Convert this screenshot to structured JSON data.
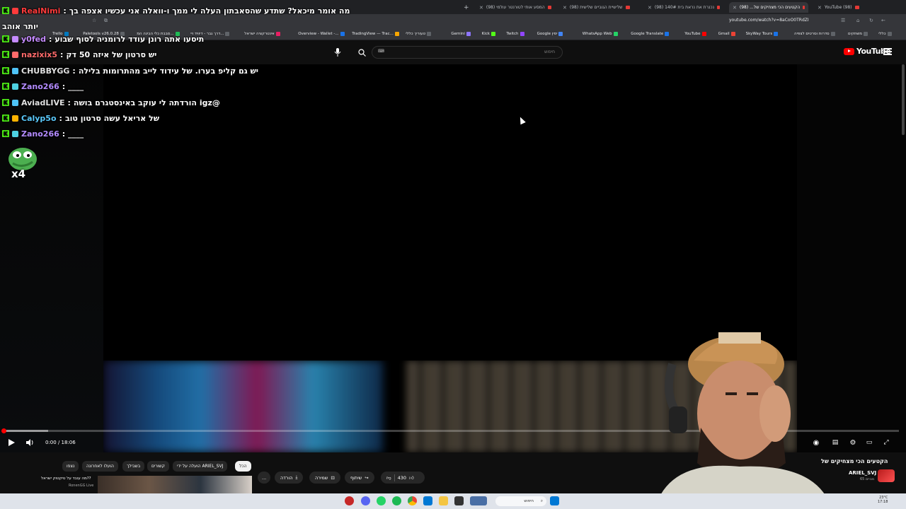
{
  "browser": {
    "tabs": [
      {
        "label": "YouTube (98)"
      },
      {
        "label": "הקטעים הכי מצחיקים של... (98)"
      },
      {
        "label": "נכנרת את נראת בית 140# (98)"
      },
      {
        "label": "שלישיית הגוביים שלישית (98)"
      },
      {
        "label": "המסע אותי לטורנטר עולמי (98)"
      }
    ],
    "new_tab": "+",
    "url": "youtube.com/watch?v=8aCoO0TRdZI",
    "bookmarks": [
      "כללי",
      "משחקים",
      "סדרות וסרטים לצפיה",
      "SkyWay Tours",
      "Gmail",
      "YouTube",
      "Google Translate",
      "WhatsApp Web",
      "Google ימין",
      "Twitch",
      "Kick",
      "Gemini",
      "טעוריך כללי",
      "TradingView — Trac...",
      "Overview - Wallet -...",
      "אינטרקציה ישראל",
      "דרך גבר - דיוויד ויי...",
      "סבבת כלי הבינה המ...",
      "Paletools v26.0.28",
      "Trello"
    ]
  },
  "youtube": {
    "logo_text": "YouTube",
    "search_placeholder": "חיפוש",
    "video": {
      "current_time": "0:00",
      "duration": "18:06",
      "time_display": "0:00 / 18:06",
      "progress": 0.0
    },
    "title": "הקטעים הכי מצחיקים של",
    "channel": "ARIEL_SVJ",
    "subscribers": "65 מנויים",
    "chips": [
      "הכל",
      "הועלה על ידי ARIEL_SVJ",
      "קשורים",
      "בשבילך",
      "הועלו לאחרונה",
      "נצפו"
    ],
    "actions": {
      "likes": "430",
      "share": "שיתוף",
      "save": "שמירה",
      "download": "הורדה",
      "more": "..."
    },
    "suggestion": {
      "title": "מה עובד על טיקטוק ישראל??",
      "channel": "RonenGG Live"
    }
  },
  "chat": [
    {
      "user": "RealNimi",
      "color": "#ff3b3b",
      "message": "מה אומר מיכאל? שתדע שהסאבתון העלה לי ממך ו-וואלה אני עכשיו אצפה בך"
    },
    {
      "user": "",
      "color": "#ffffff",
      "message": "יותר אוהב"
    },
    {
      "user": "y0fed",
      "color": "#c58bff",
      "message": "תיסעו אתה רונן עודד לרומניה לסוף שבוע"
    },
    {
      "user": "nazixix5",
      "color": "#ff6b6b",
      "message": "יש סרטון של איזה 50 דק"
    },
    {
      "user": "CHUBBYGG",
      "color": "#e0e0e0",
      "message": "יש גם קליפ בערו. של עידוד לייב מהתרומות בלילה"
    },
    {
      "user": "Zano266",
      "color": "#b38bff",
      "message": "____"
    },
    {
      "user": "AviadLIVE",
      "color": "#e0e0e0",
      "message": "@igz הורדתה לי עוקב באינסטגרם בושה"
    },
    {
      "user": "Calyp5o",
      "color": "#5ac8fa",
      "message": "של אריאל עשה סרטון טוב"
    },
    {
      "user": "Zano266",
      "color": "#b38bff",
      "message": "____"
    }
  ],
  "emote": {
    "multiplier": "x4"
  },
  "taskbar": {
    "search_placeholder": "חיפוש",
    "time": "17:18",
    "date": "23°C"
  },
  "colors": {
    "youtube_red": "#ff0000",
    "kick_green": "#53fc18"
  }
}
